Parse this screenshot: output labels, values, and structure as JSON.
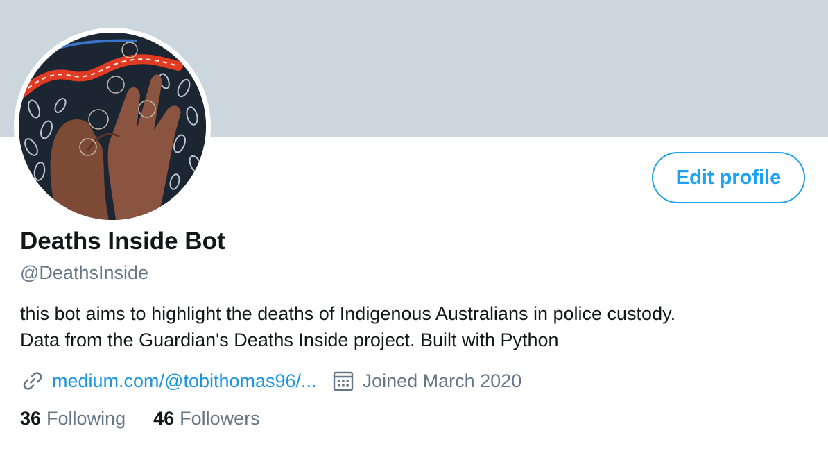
{
  "profile": {
    "name": "Deaths Inside Bot",
    "handle": "@DeathsInside",
    "bio_line1": "this bot aims to highlight the deaths of Indigenous Australians in police custody.",
    "bio_line2": "Data from the Guardian's Deaths Inside project. Built with Python",
    "link_text": "medium.com/@tobithomas96/...",
    "joined": "Joined March 2020",
    "edit_button": "Edit profile"
  },
  "stats": {
    "following_count": "36",
    "following_label": "Following",
    "followers_count": "46",
    "followers_label": "Followers"
  },
  "icons": {
    "link": "link-icon",
    "calendar": "calendar-icon"
  },
  "colors": {
    "banner": "#ccd6dd",
    "accent": "#1da1f2",
    "link": "#1b95e0",
    "primary_text": "#14171a",
    "secondary_text": "#657786"
  }
}
